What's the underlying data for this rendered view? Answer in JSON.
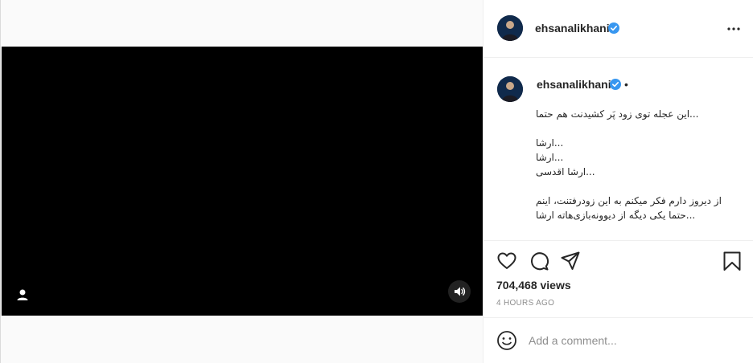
{
  "post": {
    "username": "ehsanalikhani",
    "dot": "•",
    "caption": "...این عجله توی زود پَر کشیدنت هم حتما\n\n...ارشا\n...ارشا\n...ارشا اقدسی\n\nاز دیروز دارم فکر میکنم به این زودرفتنت، اینم\n...حتما یکی دیگه از دیوونه‌بازی‌هاته ارشا",
    "views": "704,468 views",
    "time_ago": "4 HOURS AGO"
  },
  "comment": {
    "placeholder": "Add a comment..."
  },
  "colors": {
    "verified": "#3897f0",
    "video_bg": "#000000",
    "border": "#dbdbdb"
  },
  "icons": [
    "user-tag-icon",
    "speaker-icon",
    "heart-icon",
    "comment-icon",
    "share-icon",
    "bookmark-icon",
    "emoji-icon",
    "more-options-icon",
    "verified-badge-icon"
  ]
}
